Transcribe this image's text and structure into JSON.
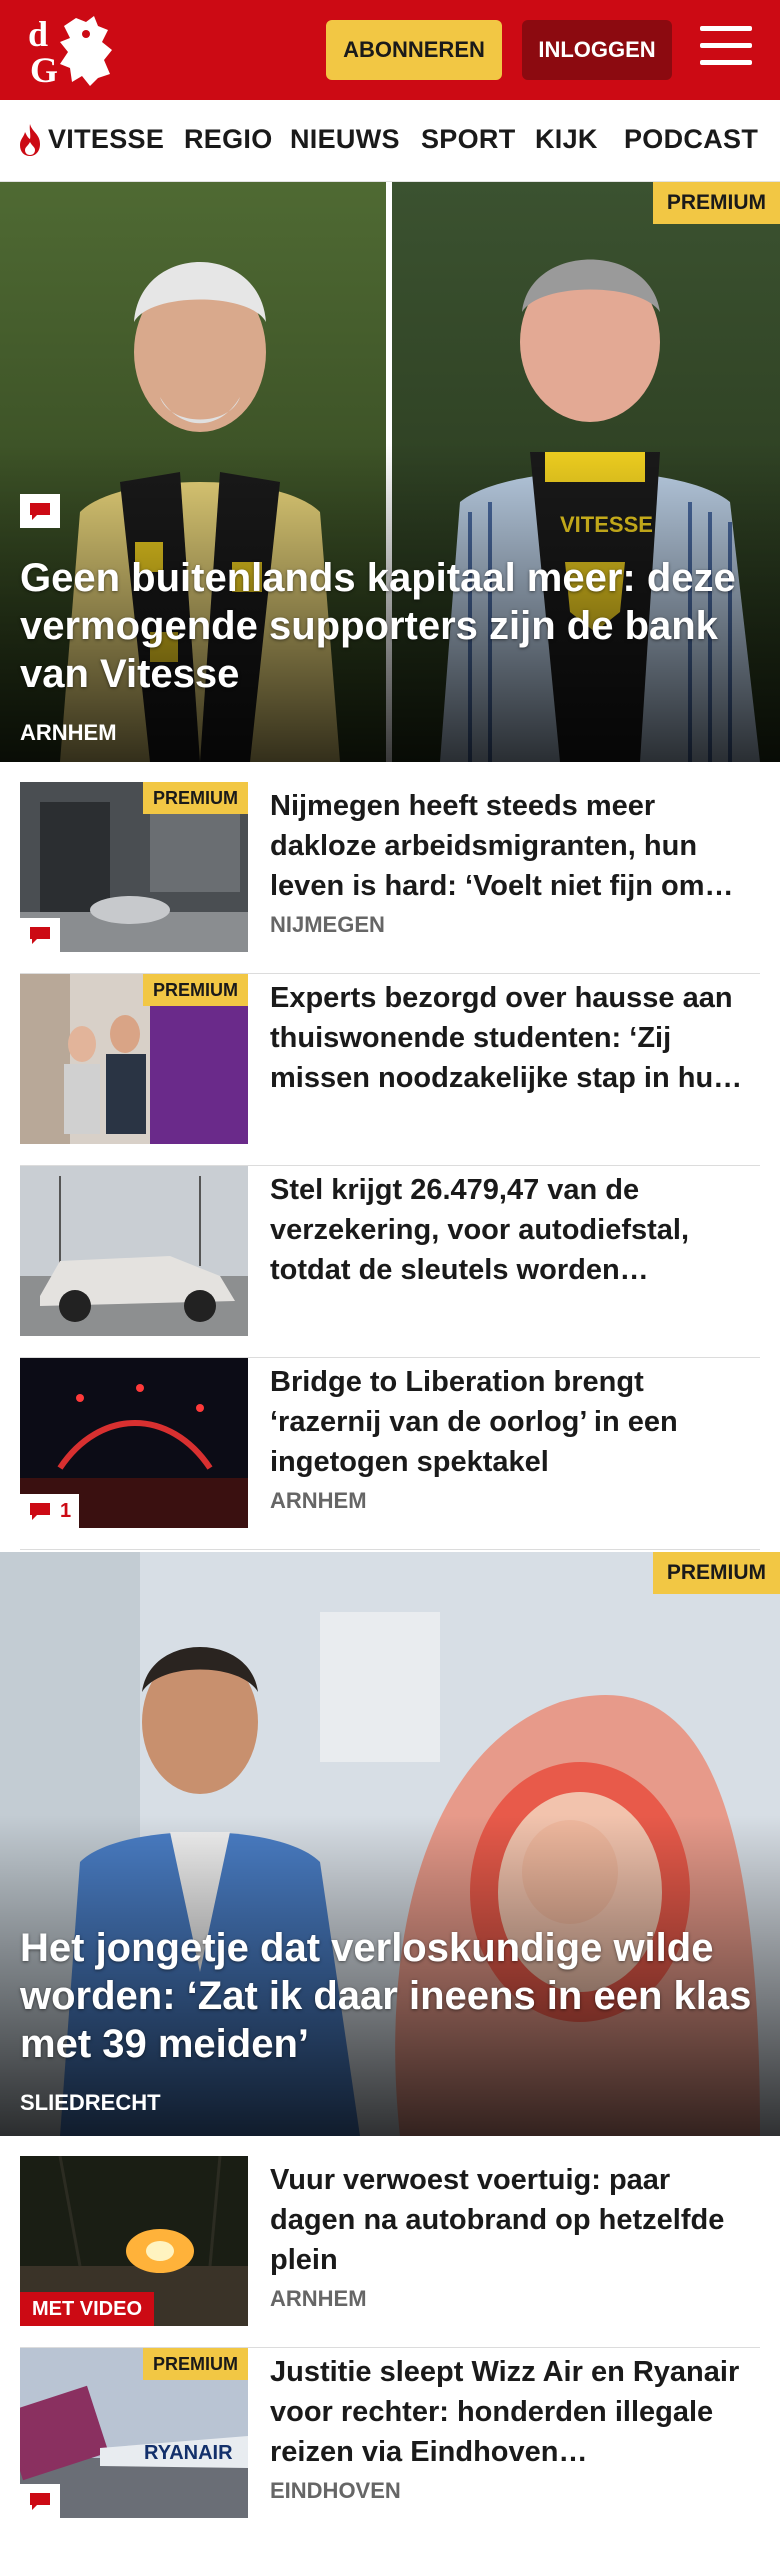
{
  "header": {
    "logo": "dG",
    "subscribe_label": "ABONNEREN",
    "login_label": "INLOGGEN"
  },
  "nav": {
    "items": [
      "VITESSE",
      "REGIO",
      "NIEUWS",
      "SPORT",
      "KIJK",
      "PODCAST"
    ]
  },
  "colors": {
    "brand_red": "#cc0a14",
    "premium_yellow": "#f2c744",
    "login_dark_red": "#8c0a10"
  },
  "hero1": {
    "title": "Geen buitenlands kapitaal meer: deze vermogende supporters zijn de bank van Vitesse",
    "category": "ARNHEM",
    "badge": "PREMIUM"
  },
  "articles1": [
    {
      "title": "Nijmegen heeft steeds meer dakloze arbeidsmigranten, hun leven is hard: ‘Voelt niet fijn om…",
      "category": "NIJMEGEN",
      "badge": "PREMIUM"
    },
    {
      "title": "Experts bezorgd over hausse aan thuiswonende studenten: ‘Zij missen noodzakelijke stap in hu…",
      "category": "",
      "badge": "PREMIUM"
    },
    {
      "title": "Stel krijgt 26.479,47 van de verzekering, voor autodiefstal, totdat de sleutels worden…",
      "category": "",
      "badge": ""
    },
    {
      "title": "Bridge to Liberation brengt ‘razernij van de oorlog’ in een ingetogen spektakel",
      "category": "ARNHEM",
      "badge": "",
      "comments": "1"
    }
  ],
  "hero2": {
    "title": "Het jongetje dat verloskundige wilde worden: ‘Zat ik daar ineens in een klas met 39 meiden’",
    "category": "SLIEDRECHT",
    "badge": "PREMIUM"
  },
  "articles2": [
    {
      "title": "Vuur verwoest voertuig: paar dagen na autobrand op hetzelfde plein",
      "category": "ARNHEM",
      "video": "MET VIDEO"
    },
    {
      "title": "Justitie sleept Wizz Air en Ryanair voor rechter: honderden illegale reizen via Eindhoven…",
      "category": "EINDHOVEN",
      "badge": "PREMIUM",
      "thumb_text": "RYANAIR"
    }
  ]
}
